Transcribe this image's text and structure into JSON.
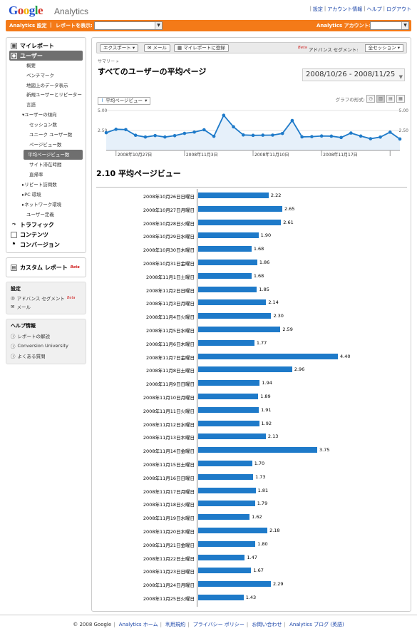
{
  "header": {
    "logo_google": "Google",
    "logo_product": "Analytics",
    "top_links": [
      "設定",
      "アカウント情報",
      "ヘルプ",
      "ログアウト"
    ]
  },
  "orangebar": {
    "settings_label": "Analytics 設定",
    "report_label": "レポートを表示:",
    "account_label": "Analytics アカウント:"
  },
  "sidebar": {
    "my_report": "マイレポート",
    "users": "ユーザー",
    "user_sub": [
      "概要",
      "ベンチマーク",
      "地図上のデータ表示",
      "新規ユーザーとリピーター",
      "言語"
    ],
    "trend": "ユーザーの傾向",
    "trend_items": [
      "セッション数",
      "ユニーク ユーザー数",
      "ページビュー数",
      "平均ページビュー数",
      "サイト滞在時間",
      "直帰率"
    ],
    "more": [
      "リピート訪問数",
      "PC 環境",
      "ネットワーク環境"
    ],
    "user_defined": "ユーザー定義",
    "traffic": "トラフィック",
    "content": "コンテンツ",
    "conversion": "コンバージョン",
    "custom_report": "カスタム レポート",
    "beta": "Beta",
    "settings_title": "設定",
    "adv_segment": "アドバンス セグメント",
    "mail": "メール",
    "help_title": "ヘルプ情報",
    "help_items": [
      "レポートの解説",
      "Conversion University",
      "よくある質問"
    ]
  },
  "toolbar": {
    "export": "エクスポート",
    "mail": "メール",
    "dashboard": "マイレポートに登録",
    "beta": "Beta",
    "adv_segment": "アドバンス セグメント:",
    "session_select": "全セッション"
  },
  "main": {
    "breadcrumb": "サマリー »",
    "title": "すべてのユーザーの平均ページ",
    "date_range": "2008/10/26 - 2008/11/25",
    "chart_tab": "平均ページビュー",
    "graph_mode_label": "グラフの形式:",
    "metric_value": "2.10",
    "metric_label": "平均ページビュー"
  },
  "chart_data": [
    {
      "type": "line",
      "y_ticks": [
        "5.00",
        "2.50"
      ],
      "ylim": [
        0,
        5
      ],
      "x_tick_labels": [
        "2008年10月27日",
        "2008年11月3日",
        "2008年11月10日",
        "2008年11月17日"
      ],
      "x": [
        "2008年10月26日",
        "2008年10月27日",
        "2008年10月28日",
        "2008年10月29日",
        "2008年10月30日",
        "2008年10月31日",
        "2008年11月1日",
        "2008年11月2日",
        "2008年11月3日",
        "2008年11月4日",
        "2008年11月5日",
        "2008年11月6日",
        "2008年11月7日",
        "2008年11月8日",
        "2008年11月9日",
        "2008年11月10日",
        "2008年11月11日",
        "2008年11月12日",
        "2008年11月13日",
        "2008年11月14日",
        "2008年11月15日",
        "2008年11月16日",
        "2008年11月17日",
        "2008年11月18日",
        "2008年11月19日",
        "2008年11月20日",
        "2008年11月21日",
        "2008年11月22日",
        "2008年11月23日",
        "2008年11月24日",
        "2008年11月25日"
      ],
      "values": [
        2.22,
        2.65,
        2.61,
        1.9,
        1.68,
        1.86,
        1.68,
        1.85,
        2.14,
        2.3,
        2.59,
        1.77,
        4.4,
        2.96,
        1.94,
        1.89,
        1.91,
        1.92,
        2.13,
        3.75,
        1.7,
        1.73,
        1.81,
        1.79,
        1.62,
        2.18,
        1.8,
        1.47,
        1.67,
        2.29,
        1.43
      ]
    },
    {
      "type": "bar",
      "categories": [
        "2008年10月26日日曜日",
        "2008年10月27日月曜日",
        "2008年10月28日火曜日",
        "2008年10月29日水曜日",
        "2008年10月30日木曜日",
        "2008年10月31日金曜日",
        "2008年11月1日土曜日",
        "2008年11月2日日曜日",
        "2008年11月3日月曜日",
        "2008年11月4日火曜日",
        "2008年11月5日水曜日",
        "2008年11月6日木曜日",
        "2008年11月7日金曜日",
        "2008年11月8日土曜日",
        "2008年11月9日日曜日",
        "2008年11月10日月曜日",
        "2008年11月11日火曜日",
        "2008年11月12日水曜日",
        "2008年11月13日木曜日",
        "2008年11月14日金曜日",
        "2008年11月15日土曜日",
        "2008年11月16日日曜日",
        "2008年11月17日月曜日",
        "2008年11月18日火曜日",
        "2008年11月19日水曜日",
        "2008年11月20日木曜日",
        "2008年11月21日金曜日",
        "2008年11月22日土曜日",
        "2008年11月23日日曜日",
        "2008年11月24日月曜日",
        "2008年11月25日火曜日"
      ],
      "values": [
        2.22,
        2.65,
        2.61,
        1.9,
        1.68,
        1.86,
        1.68,
        1.85,
        2.14,
        2.3,
        2.59,
        1.77,
        4.4,
        2.96,
        1.94,
        1.89,
        1.91,
        1.92,
        2.13,
        3.75,
        1.7,
        1.73,
        1.81,
        1.79,
        1.62,
        2.18,
        1.8,
        1.47,
        1.67,
        2.29,
        1.43
      ],
      "value_labels": [
        "2.22",
        "2.65",
        "2.61",
        "1.90",
        "1.68",
        "1.86",
        "1.68",
        "1.85",
        "2.14",
        "2.30",
        "2.59",
        "1.77",
        "4.40",
        "2.96",
        "1.94",
        "1.89",
        "1.91",
        "1.92",
        "2.13",
        "3.75",
        "1.70",
        "1.73",
        "1.81",
        "1.79",
        "1.62",
        "2.18",
        "1.80",
        "1.47",
        "1.67",
        "2.29",
        "1.43"
      ],
      "xlim": [
        0,
        4.4
      ]
    }
  ],
  "footer": {
    "copyright": "© 2008 Google",
    "links": [
      "Analytics ホーム",
      "利用規約",
      "プライバシー ポリシー",
      "お問い合わせ",
      "Analytics ブログ (英語)"
    ]
  },
  "colors": {
    "orange": "#f47a18",
    "bar": "#1e7ac9",
    "line": "#1e7ac9",
    "area": "#e6f0fa"
  }
}
